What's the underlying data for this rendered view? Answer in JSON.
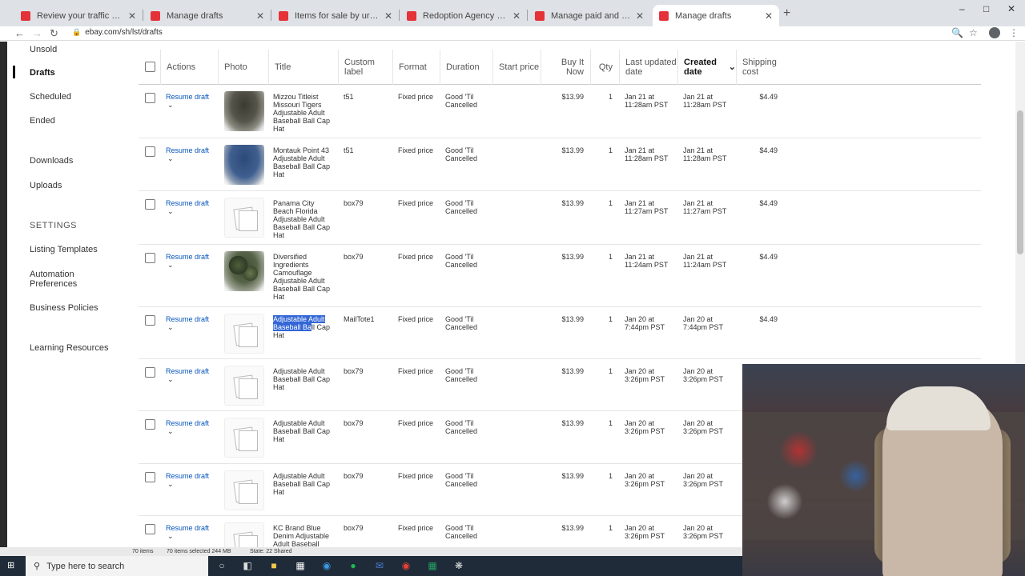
{
  "browser": {
    "tabs": [
      {
        "title": "Review your traffic reports — eB",
        "active": false
      },
      {
        "title": "Manage drafts",
        "active": false
      },
      {
        "title": "Items for sale by urban_picker | e",
        "active": false
      },
      {
        "title": "Redoption Agency | eBay Stores",
        "active": false
      },
      {
        "title": "Manage paid and shipped order",
        "active": false
      },
      {
        "title": "Manage drafts",
        "active": true
      }
    ],
    "new_tab_icon": "plus-icon",
    "url": "ebay.com/sh/lst/drafts"
  },
  "sidebar": {
    "items": [
      {
        "label": "Unsold",
        "active": false
      },
      {
        "label": "Drafts",
        "active": true
      },
      {
        "label": "Scheduled",
        "active": false
      },
      {
        "label": "Ended",
        "active": false
      },
      {
        "label": "Downloads",
        "active": false
      },
      {
        "label": "Uploads",
        "active": false
      }
    ],
    "settings_heading": "SETTINGS",
    "settings_items": [
      {
        "label": "Listing Templates"
      },
      {
        "label": "Automation Preferences"
      },
      {
        "label": "Business Policies"
      },
      {
        "label": "Learning Resources"
      }
    ]
  },
  "table": {
    "columns": {
      "actions": "Actions",
      "photo": "Photo",
      "title": "Title",
      "custom_label": "Custom label",
      "format": "Format",
      "duration": "Duration",
      "start_price": "Start price",
      "buy_it_now": "Buy It Now",
      "qty": "Qty",
      "last_updated": "Last updated date",
      "created_date": "Created date",
      "shipping_cost": "Shipping cost"
    },
    "action_label": "Resume draft",
    "rows": [
      {
        "title": "Mizzou Titleist Missouri Tigers Adjustable Adult Baseball Ball Cap Hat",
        "custom_label": "t51",
        "format": "Fixed price",
        "duration": "Good 'Til Cancelled",
        "start_price": "",
        "price": "$13.99",
        "qty": "1",
        "last_updated": "Jan 21 at 11:28am PST",
        "created": "Jan 21 at 11:28am PST",
        "shipping": "$4.49",
        "photo": "hat-dark"
      },
      {
        "title": "Montauk Point 43 Adjustable Adult Baseball Ball Cap Hat",
        "custom_label": "t51",
        "format": "Fixed price",
        "duration": "Good 'Til Cancelled",
        "start_price": "",
        "price": "$13.99",
        "qty": "1",
        "last_updated": "Jan 21 at 11:28am PST",
        "created": "Jan 21 at 11:28am PST",
        "shipping": "$4.49",
        "photo": "hat-blue"
      },
      {
        "title": "Panama City Beach Florida Adjustable Adult Baseball Ball Cap Hat",
        "custom_label": "box79",
        "format": "Fixed price",
        "duration": "Good 'Til Cancelled",
        "start_price": "",
        "price": "$13.99",
        "qty": "1",
        "last_updated": "Jan 21 at 11:27am PST",
        "created": "Jan 21 at 11:27am PST",
        "shipping": "$4.49",
        "photo": "placeholder"
      },
      {
        "title": "Diversified Ingredients Camouflage Adjustable Adult Baseball Ball Cap Hat",
        "custom_label": "box79",
        "format": "Fixed price",
        "duration": "Good 'Til Cancelled",
        "start_price": "",
        "price": "$13.99",
        "qty": "1",
        "last_updated": "Jan 21 at 11:24am PST",
        "created": "Jan 21 at 11:24am PST",
        "shipping": "$4.49",
        "photo": "hat-camo"
      },
      {
        "title": "Adjustable Adult Baseball Ball Cap Hat",
        "custom_label": "MailTote1",
        "format": "Fixed price",
        "duration": "Good 'Til Cancelled",
        "start_price": "",
        "price": "$13.99",
        "qty": "1",
        "last_updated": "Jan 20 at 7:44pm PST",
        "created": "Jan 20 at 7:44pm PST",
        "shipping": "$4.49",
        "photo": "placeholder"
      },
      {
        "title": "Adjustable Adult Baseball Ball Cap Hat",
        "custom_label": "box79",
        "format": "Fixed price",
        "duration": "Good 'Til Cancelled",
        "start_price": "",
        "price": "$13.99",
        "qty": "1",
        "last_updated": "Jan 20 at 3:26pm PST",
        "created": "Jan 20 at 3:26pm PST",
        "shipping": "",
        "photo": "placeholder"
      },
      {
        "title": "Adjustable Adult Baseball Ball Cap Hat",
        "custom_label": "box79",
        "format": "Fixed price",
        "duration": "Good 'Til Cancelled",
        "start_price": "",
        "price": "$13.99",
        "qty": "1",
        "last_updated": "Jan 20 at 3:26pm PST",
        "created": "Jan 20 at 3:26pm PST",
        "shipping": "",
        "photo": "placeholder"
      },
      {
        "title": "Adjustable Adult Baseball Ball Cap Hat",
        "custom_label": "box79",
        "format": "Fixed price",
        "duration": "Good 'Til Cancelled",
        "start_price": "",
        "price": "$13.99",
        "qty": "1",
        "last_updated": "Jan 20 at 3:26pm PST",
        "created": "Jan 20 at 3:26pm PST",
        "shipping": "",
        "photo": "placeholder"
      },
      {
        "title": "KC Brand Blue Denim Adjustable Adult Baseball Ball",
        "custom_label": "box79",
        "format": "Fixed price",
        "duration": "Good 'Til Cancelled",
        "start_price": "",
        "price": "$13.99",
        "qty": "1",
        "last_updated": "Jan 20 at 3:26pm PST",
        "created": "Jan 20 at 3:26pm PST",
        "shipping": "",
        "photo": "placeholder"
      }
    ]
  },
  "explorer_status": {
    "items_count": "70 items",
    "selected": "70 items selected  244 MB",
    "state": "State: 22 Shared"
  },
  "taskbar": {
    "search_placeholder": "Type here to search"
  }
}
